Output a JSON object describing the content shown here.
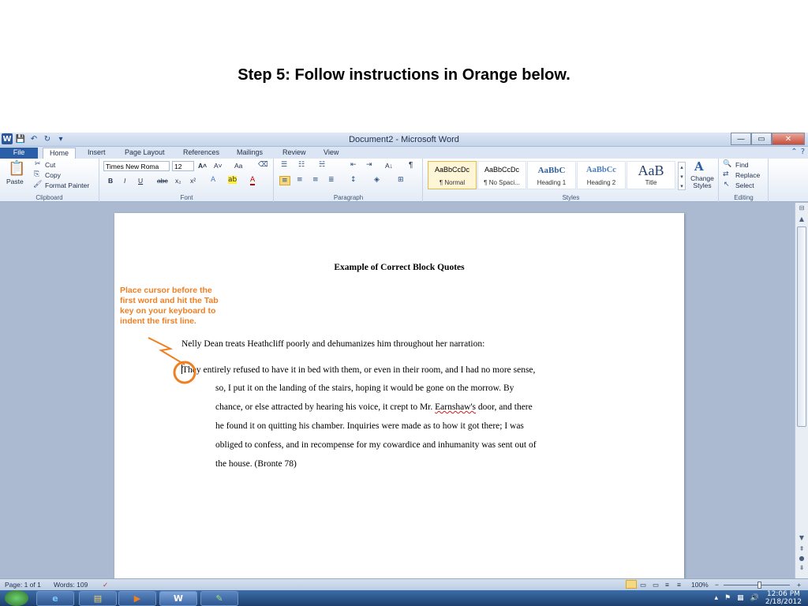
{
  "slide": {
    "title": "Step 5: Follow instructions in Orange below."
  },
  "window": {
    "title": "Document2 - Microsoft Word",
    "qat": {
      "app_icon": "W",
      "save": "💾",
      "undo": "↶",
      "redo": "↻",
      "customize": "▾"
    },
    "controls": {
      "minimize": "—",
      "maximize": "▭",
      "close": "✕"
    }
  },
  "tabs": [
    "File",
    "Home",
    "Insert",
    "Page Layout",
    "References",
    "Mailings",
    "Review",
    "View"
  ],
  "ribbon": {
    "clipboard": {
      "label": "Clipboard",
      "paste": "Paste",
      "cut": "Cut",
      "copy": "Copy",
      "format_painter": "Format Painter"
    },
    "font": {
      "label": "Font",
      "family": "Times New Roma",
      "size": "12",
      "bold": "B",
      "italic": "I",
      "underline": "U",
      "strike": "abc",
      "subscript": "x₂",
      "superscript": "x²",
      "grow": "A˄",
      "shrink": "A˅",
      "case": "Aa",
      "clear": "A"
    },
    "paragraph": {
      "label": "Paragraph",
      "pilcrow": "¶",
      "sort": "A↓"
    },
    "styles": {
      "label": "Styles",
      "items": [
        {
          "sample": "AaBbCcDc",
          "name": "¶ Normal"
        },
        {
          "sample": "AaBbCcDc",
          "name": "¶ No Spaci..."
        },
        {
          "sample": "AaBbC",
          "name": "Heading 1"
        },
        {
          "sample": "AaBbCc",
          "name": "Heading 2"
        },
        {
          "sample": "AaB",
          "name": "Title"
        }
      ],
      "change_styles": "Change Styles"
    },
    "editing": {
      "label": "Editing",
      "find": "Find",
      "replace": "Replace",
      "select": "Select"
    }
  },
  "document": {
    "heading": "Example of Correct Block Quotes",
    "intro": "Nelly Dean treats Heathcliff poorly and dehumanizes him throughout her narration:",
    "quote_lines": [
      "They entirely refused to have it in bed with them, or even in their room, and I had no more sense,",
      "so, I put it on the landing of the stairs, hoping it would be gone on the morrow. By",
      "chance, or else attracted by hearing his voice, it crept to Mr. ",
      "he found it on quitting his chamber. Inquiries were made as to how it got there; I was",
      "obliged to confess, and in recompense for my cowardice and inhumanity was sent out of",
      "the house. (Bronte 78)"
    ],
    "misspelled": "Earnshaw's",
    "line3_tail": " door, and there"
  },
  "callout": {
    "text": "Place cursor before the first word and hit the Tab key on your keyboard to indent the first line.",
    "color": "#f07f22"
  },
  "status": {
    "page": "Page: 1 of 1",
    "words": "Words: 109",
    "zoom": "100%",
    "zoom_out": "−",
    "zoom_in": "+"
  },
  "taskbar": {
    "time": "12:06 PM",
    "date": "2/18/2012"
  }
}
